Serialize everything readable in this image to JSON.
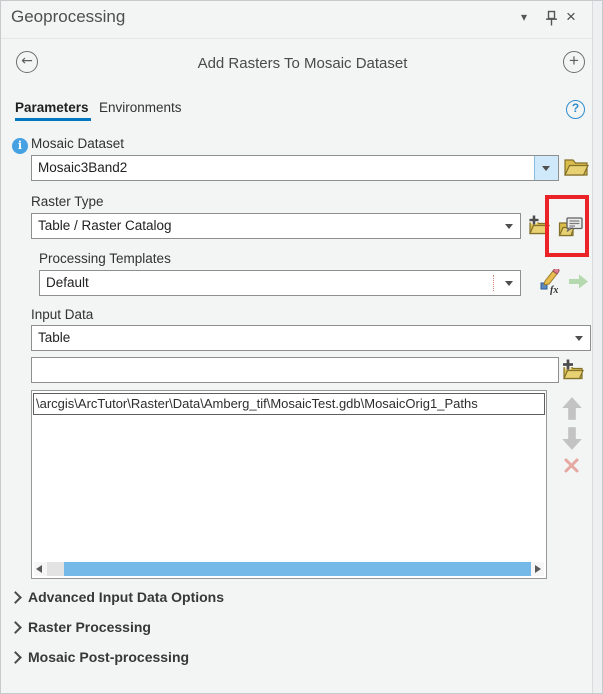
{
  "titlebar": {
    "title": "Geoprocessing"
  },
  "header": {
    "title": "Add Rasters To Mosaic Dataset"
  },
  "tabs": {
    "parameters": "Parameters",
    "environments": "Environments"
  },
  "form": {
    "mosaic_dataset": {
      "label": "Mosaic Dataset",
      "value": "Mosaic3Band2"
    },
    "raster_type": {
      "label": "Raster Type",
      "value": "Table / Raster Catalog"
    },
    "processing_templates": {
      "label": "Processing Templates",
      "value": "Default"
    },
    "input_data": {
      "label": "Input Data",
      "value": "Table"
    },
    "new_input": {
      "value": "",
      "placeholder": ""
    },
    "input_list": {
      "rows": [
        "\\arcgis\\ArcTutor\\Raster\\Data\\Amberg_tif\\MosaicTest.gdb\\MosaicOrig1_Paths"
      ]
    }
  },
  "sections": [
    {
      "label": "Advanced Input Data Options"
    },
    {
      "label": "Raster Processing"
    },
    {
      "label": "Mosaic Post-processing"
    }
  ],
  "icons": {
    "titlebar_chevron": "▾",
    "close": "×",
    "back_arrow": "←",
    "add_plus": "+",
    "help_q": "?",
    "info_i": "i",
    "fx_label": "fx"
  },
  "colors": {
    "accent_blue": "#0077be",
    "folder_yellow": "#d9bc4a",
    "annotation_red": "#ec2326",
    "scrollbar_thumb_blue": "#74b9e7",
    "combo_button_highlight": "#cfe9fb"
  }
}
